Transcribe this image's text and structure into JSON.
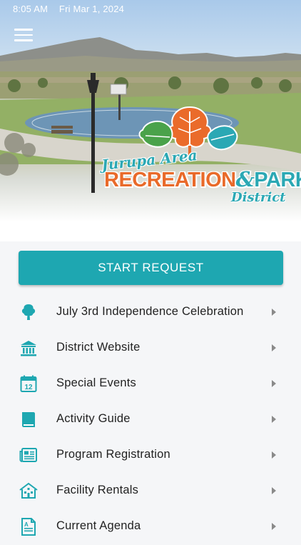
{
  "status_bar": {
    "time": "8:05 AM",
    "date": "Fri Mar 1, 2024"
  },
  "header": {
    "logo_line1": "Jurupa Area",
    "logo_word1": "RECREATION",
    "logo_amp": "&",
    "logo_word2": "PARK",
    "logo_line3": "District"
  },
  "actions": {
    "start_request": "START REQUEST"
  },
  "accent_color": "#1ea7b1",
  "menu": [
    {
      "label": "July 3rd Independence Celebration",
      "icon": "tree-icon"
    },
    {
      "label": "District Website",
      "icon": "building-icon"
    },
    {
      "label": "Special Events",
      "icon": "calendar-icon"
    },
    {
      "label": "Activity Guide",
      "icon": "book-icon"
    },
    {
      "label": "Program Registration",
      "icon": "newspaper-icon"
    },
    {
      "label": "Facility Rentals",
      "icon": "house-icon"
    },
    {
      "label": "Current Agenda",
      "icon": "document-icon"
    }
  ]
}
